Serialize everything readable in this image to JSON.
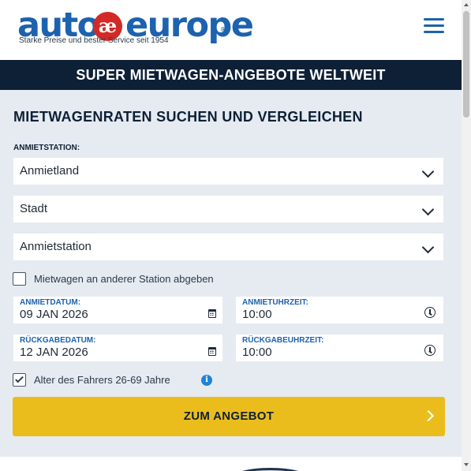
{
  "header": {
    "logo_auto": "auto",
    "logo_ae": "æ",
    "logo_europe": "europe",
    "logo_reg": "®",
    "tagline": "Starke Preise und bester Service seit 1954",
    "menu_icon": "hamburger-menu-icon"
  },
  "banner": {
    "text": "SUPER MIETWAGEN-ANGEBOTE WELTWEIT"
  },
  "form": {
    "title": "MIETWAGENRATEN SUCHEN UND VERGLEICHEN",
    "pickup_label": "ANMIETSTATION:",
    "country_select": "Anmietland",
    "city_select": "Stadt",
    "station_select": "Anmietstation",
    "different_return_label": "Mietwagen an anderer Station abgeben",
    "different_return_checked": false,
    "pickup_date_label": "ANMIETDATUM:",
    "pickup_date": "09 JAN 2026",
    "pickup_time_label": "ANMIETUHRZEIT:",
    "pickup_time": "10:00",
    "return_date_label": "RÜCKGABEDATUM:",
    "return_date": "12 JAN 2026",
    "return_time_label": "RÜCKGABEUHRZEIT:",
    "return_time": "10:00",
    "driver_age_label": "Alter des Fahrers 26-69 Jahre",
    "driver_age_checked": true,
    "info_icon_glyph": "i",
    "submit_label": "ZUM ANGEBOT"
  },
  "colors": {
    "brand_blue": "#1d62ae",
    "logo_red": "#d32a27",
    "banner_navy": "#0e2036",
    "form_background": "#e6ebf1",
    "cta_yellow": "#ebbd1c",
    "info_blue": "#1d84d8"
  }
}
